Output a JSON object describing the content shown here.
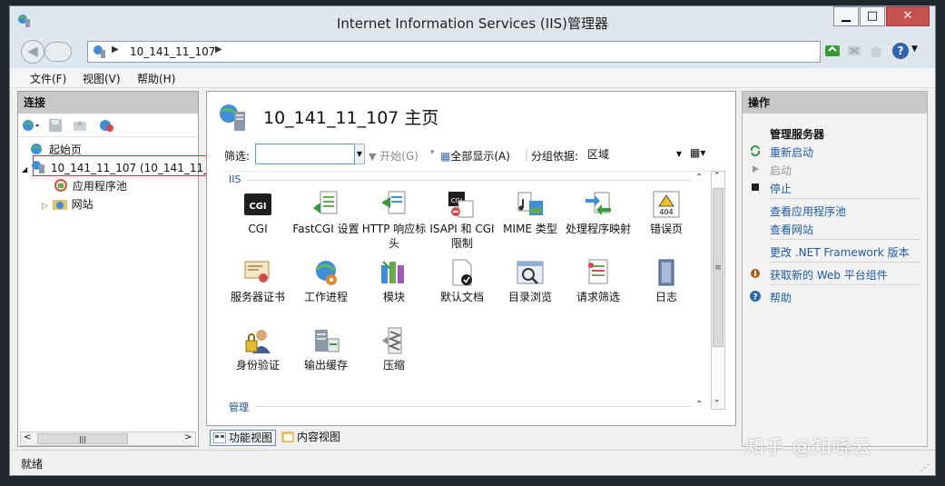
{
  "window": {
    "title": "Internet Information Services (IIS)管理器"
  },
  "address": {
    "path": "10_141_11_107"
  },
  "menu": [
    "文件(F)",
    "视图(V)",
    "帮助(H)"
  ],
  "connections": {
    "header": "连接",
    "tree": {
      "start_page": "起始页",
      "server": "10_141_11_107 (10_141_11_",
      "app_pools": "应用程序池",
      "sites": "网站"
    }
  },
  "main": {
    "title": "10_141_11_107 主页",
    "filter_label": "筛选:",
    "filter_value": "",
    "start_label": "开始(G)",
    "show_all_label": "全部显示(A)",
    "group_by_label": "分组依据:",
    "group_by_value": "区域",
    "sections": {
      "iis": "IIS",
      "manage": "管理"
    },
    "features": [
      {
        "icon": "cgi-icon",
        "label": "CGI"
      },
      {
        "icon": "fastcgi-icon",
        "label": "FastCGI 设置"
      },
      {
        "icon": "http-response-headers-icon",
        "label": "HTTP 响应标头"
      },
      {
        "icon": "isapi-cgi-restrictions-icon",
        "label": "ISAPI 和 CGI 限制"
      },
      {
        "icon": "mime-types-icon",
        "label": "MIME 类型"
      },
      {
        "icon": "handler-mappings-icon",
        "label": "处理程序映射"
      },
      {
        "icon": "error-pages-icon",
        "label": "错误页"
      },
      {
        "icon": "server-certificates-icon",
        "label": "服务器证书"
      },
      {
        "icon": "worker-processes-icon",
        "label": "工作进程"
      },
      {
        "icon": "modules-icon",
        "label": "模块"
      },
      {
        "icon": "default-document-icon",
        "label": "默认文档"
      },
      {
        "icon": "directory-browsing-icon",
        "label": "目录浏览"
      },
      {
        "icon": "request-filtering-icon",
        "label": "请求筛选"
      },
      {
        "icon": "logging-icon",
        "label": "日志"
      },
      {
        "icon": "authentication-icon",
        "label": "身份验证"
      },
      {
        "icon": "output-caching-icon",
        "label": "输出缓存"
      },
      {
        "icon": "compression-icon",
        "label": "压缩"
      }
    ],
    "error_icon_text": "404"
  },
  "view_tabs": {
    "feature": "功能视图",
    "content": "内容视图"
  },
  "actions": {
    "header": "操作",
    "manage_server": "管理服务器",
    "restart": "重新启动",
    "start": "启动",
    "stop": "停止",
    "view_app_pools": "查看应用程序池",
    "view_sites": "查看网站",
    "change_net": "更改 .NET Framework 版本",
    "get_components": "获取新的 Web 平台组件",
    "help": "帮助"
  },
  "status": {
    "text": "就绪"
  },
  "watermark": "知乎 @知晓云",
  "colors": {
    "link": "#1d5aa6",
    "selection_border": "#c13030",
    "titlebar": "#dfe6ee"
  }
}
